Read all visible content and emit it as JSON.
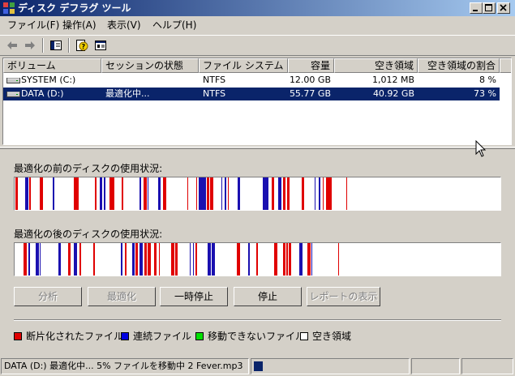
{
  "window": {
    "title": "ディスク デフラグ ツール",
    "title_icon": "defrag-app-icon",
    "controls": [
      "minimize-icon",
      "maximize-icon",
      "close-icon"
    ]
  },
  "menu": [
    {
      "label": "ファイル(F)"
    },
    {
      "label": "操作(A)"
    },
    {
      "label": "表示(V)"
    },
    {
      "label": "ヘルプ(H)"
    }
  ],
  "toolbar": {
    "icons": [
      "back-arrow-icon",
      "forward-arrow-icon",
      "show-hide-console-tree-icon",
      "help-icon",
      "properties-icon"
    ]
  },
  "volumes": {
    "columns": [
      "ボリューム",
      "セッションの状態",
      "ファイル システム",
      "容量",
      "空き領域",
      "空き領域の割合"
    ],
    "rows": [
      {
        "volume": "SYSTEM (C:)",
        "status": "",
        "fs": "NTFS",
        "capacity": "12.00 GB",
        "free": "1,012 MB",
        "percent": "8 %",
        "selected": false
      },
      {
        "volume": "DATA (D:)",
        "status": "最適化中...",
        "fs": "NTFS",
        "capacity": "55.77 GB",
        "free": "40.92 GB",
        "percent": "73 %",
        "selected": true
      }
    ]
  },
  "analysis": {
    "before_label": "最適化の前のディスクの使用状況:",
    "after_label": "最適化の後のディスクの使用状況:"
  },
  "buttons": {
    "analyze": "分析",
    "defragment": "最適化",
    "pause": "一時停止",
    "stop": "停止",
    "view_report": "レポートの表示"
  },
  "legend": [
    {
      "label": "断片化されたファイル",
      "color": "#e00000"
    },
    {
      "label": "連続ファイル",
      "color": "#0000e0"
    },
    {
      "label": "移動できないファイル",
      "color": "#00e000"
    },
    {
      "label": "空き領域",
      "color": "#ffffff"
    }
  ],
  "colors": {
    "fragmented": "#e00000",
    "contiguous": "#1a10b0",
    "unmovable": "#00e000",
    "free": "#ffffff",
    "selection": "#0a246a"
  },
  "status": {
    "text": "DATA (D:) 最適化中... 5% ファイルを移動中 2 Fever.mp3",
    "progress": 0.05
  }
}
